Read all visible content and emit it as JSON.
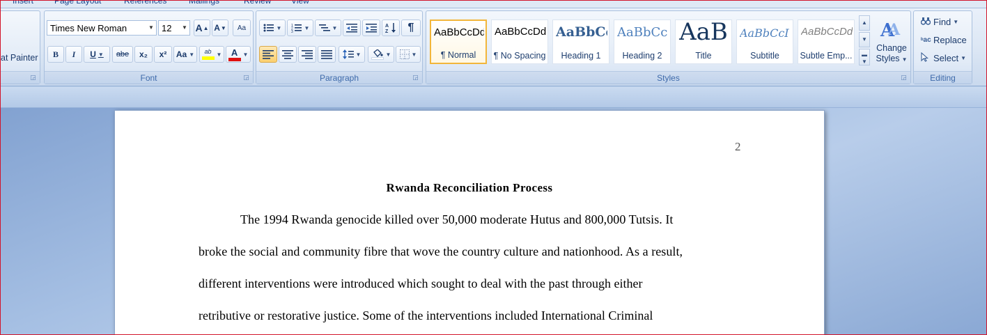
{
  "tabs": [
    "Insert",
    "Page Layout",
    "References",
    "Mailings",
    "Review",
    "View"
  ],
  "clipboard": {
    "format_painter_label": "at Painter"
  },
  "font": {
    "group_label": "Font",
    "font_name": "Times New Roman",
    "font_size": "12",
    "grow_label": "A",
    "shrink_label": "A",
    "clear_label": "Aa",
    "bold_label": "B",
    "italic_label": "I",
    "underline_label": "U",
    "strike_label": "abe",
    "subscript_label": "x₂",
    "superscript_label": "x²",
    "case_label": "Aa",
    "highlight_label": "ab",
    "font_color_label": "A",
    "highlight_color": "#ffff00",
    "font_color": "#e01010"
  },
  "paragraph": {
    "group_label": "Paragraph"
  },
  "styles": {
    "group_label": "Styles",
    "items": [
      {
        "sample": "AaBbCcDd",
        "name": "¶ Normal"
      },
      {
        "sample": "AaBbCcDd",
        "name": "¶ No Spacing"
      },
      {
        "sample": "AaBbCc",
        "name": "Heading 1"
      },
      {
        "sample": "AaBbCc",
        "name": "Heading 2"
      },
      {
        "sample": "AaB",
        "name": "Title"
      },
      {
        "sample": "AaBbCcI",
        "name": "Subtitle"
      },
      {
        "sample": "AaBbCcDd",
        "name": "Subtle Emp..."
      }
    ],
    "change_styles_line1": "Change",
    "change_styles_line2": "Styles"
  },
  "editing": {
    "group_label": "Editing",
    "find_label": "Find",
    "replace_label": "Replace",
    "select_label": "Select"
  },
  "document": {
    "page_number": "2",
    "title": "Rwanda Reconciliation Process",
    "lines": [
      "The 1994 Rwanda genocide killed over 50,000 moderate Hutus and 800,000 Tutsis. It",
      "broke the social and community fibre that wove the country culture and nationhood. As a result,",
      "different interventions were introduced which sought to deal with the past through either",
      "retributive or restorative justice. Some of the interventions included International Criminal"
    ]
  },
  "colors": {
    "ribbon_text": "#15428b",
    "group_label": "#3e6aaa",
    "active_style_border": "#f2b63a"
  }
}
